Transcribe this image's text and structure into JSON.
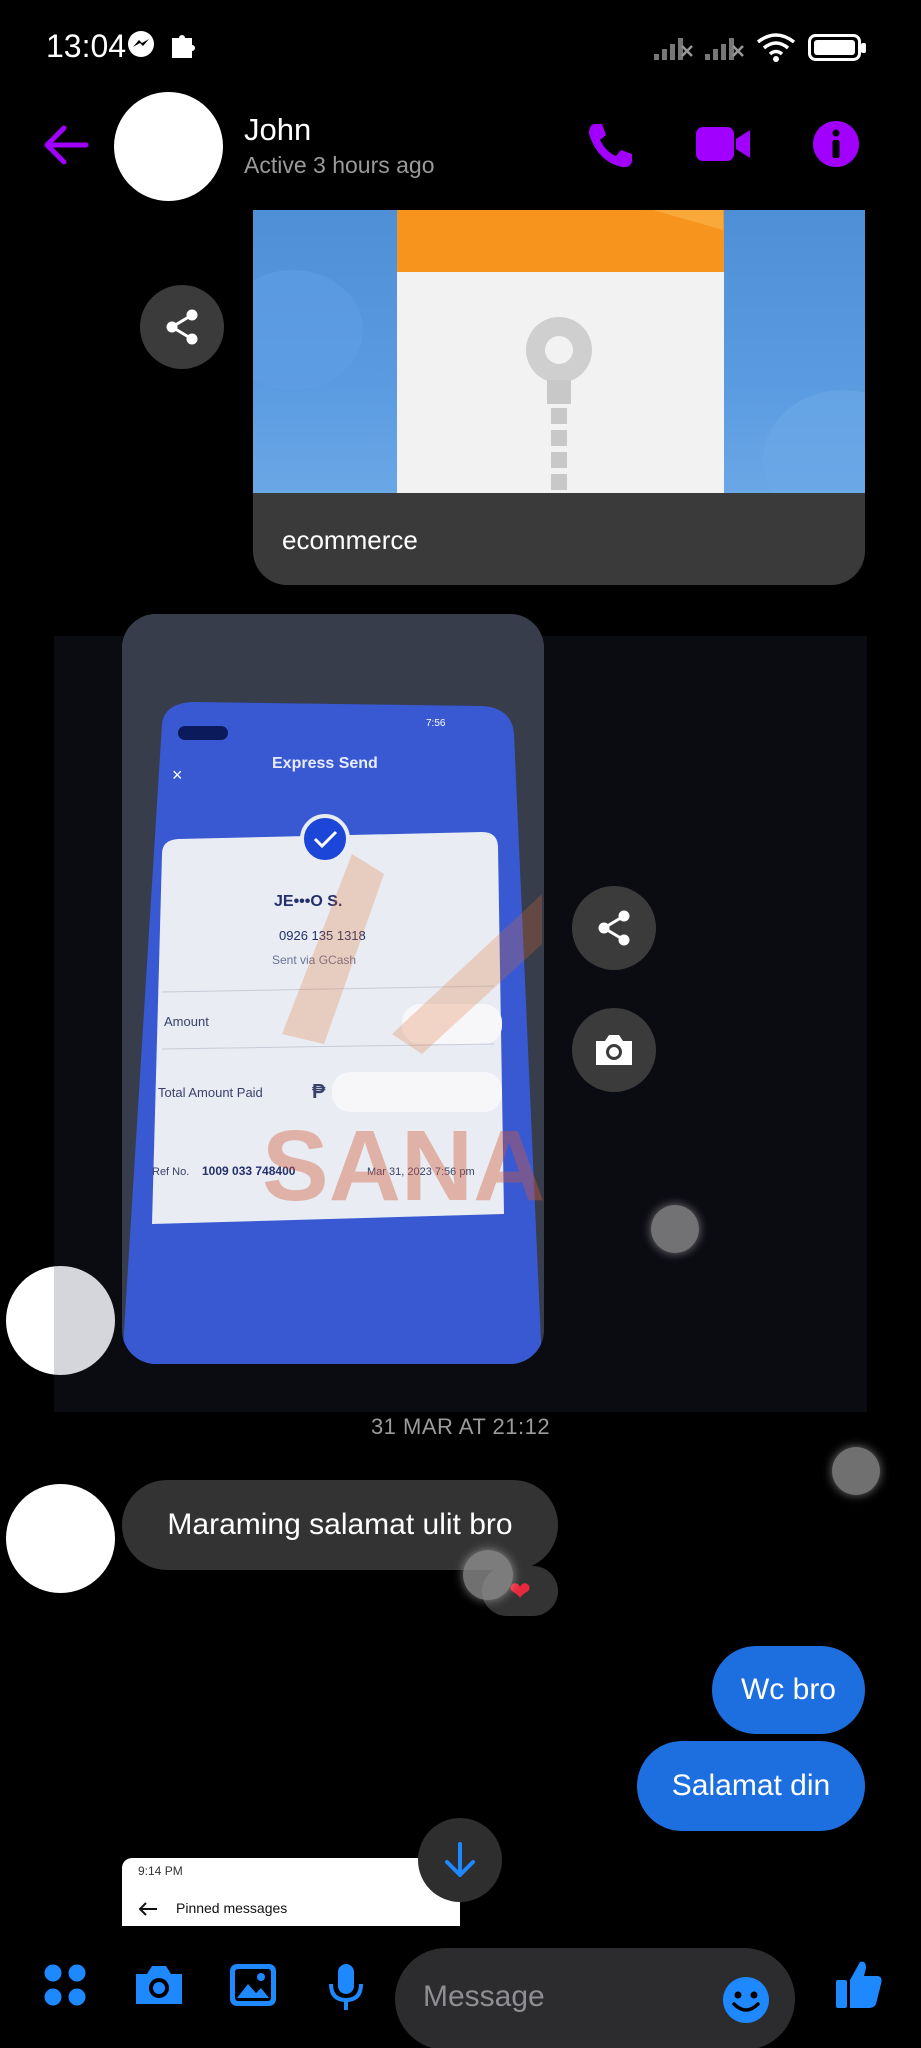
{
  "status_bar": {
    "time": "13:04",
    "icons": [
      "messenger-icon",
      "puzzle-icon",
      "signal-off-icon",
      "signal-off-icon",
      "wifi-icon",
      "battery-icon"
    ]
  },
  "header": {
    "contact_name": "John",
    "contact_status": "Active 3 hours ago",
    "accent_color": "#a100ff",
    "actions": [
      "back-arrow-icon",
      "phone-icon",
      "video-camera-icon",
      "info-icon"
    ]
  },
  "attachment": {
    "file_name": "ecommerce",
    "icon": "zip-archive-icon"
  },
  "photo": {
    "header_title": "Express Send",
    "recipient_name": "JE•••O S.",
    "recipient_number": "0926 135 1318",
    "sent_via": "Sent via GCash",
    "amount_label": "Amount",
    "total_label": "Total Amount Paid",
    "currency_symbol": "₱",
    "ref_label": "Ref No.",
    "ref_number": "1009 033 748400",
    "date": "Mar 31, 2023 7:56 pm",
    "phone_time": "7:56",
    "watermark": "SANARA"
  },
  "timestamp": "31 MAR AT 21:12",
  "messages": [
    {
      "direction": "in",
      "text": "Maraming salamat ulit bro",
      "reaction": "❤"
    },
    {
      "direction": "out",
      "text": "Wc bro"
    },
    {
      "direction": "out",
      "text": "Salamat din"
    }
  ],
  "pinned_preview": {
    "time": "9:14 PM",
    "title": "Pinned messages"
  },
  "composer": {
    "placeholder": "Message",
    "icon_color": "#1e88ff",
    "icons": [
      "menu-grid-icon",
      "camera-icon",
      "gallery-icon",
      "microphone-icon",
      "emoji-icon",
      "thumbs-up-icon"
    ]
  }
}
